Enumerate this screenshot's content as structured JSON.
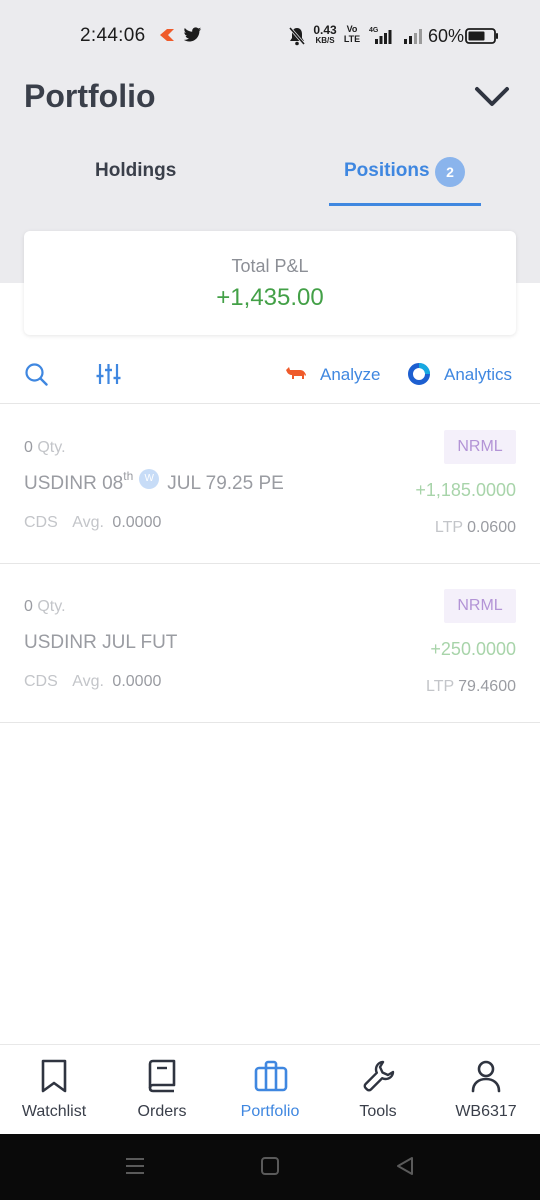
{
  "status_bar": {
    "time": "2:44:06",
    "net_speed": "0.43",
    "net_unit": "KB/S",
    "volte": "Vo LTE",
    "battery": "60%"
  },
  "header": {
    "title": "Portfolio"
  },
  "tabs": [
    {
      "label": "Holdings",
      "active": false
    },
    {
      "label": "Positions",
      "active": true,
      "badge": "2"
    }
  ],
  "pnl": {
    "label": "Total P&L",
    "value": "+1,435.00"
  },
  "toolbar": {
    "analyze_label": "Analyze",
    "analytics_label": "Analytics"
  },
  "positions": [
    {
      "qty": "0",
      "qty_label": "Qty.",
      "symbol_prefix": "USDINR 08",
      "symbol_sup": "th",
      "weekly_tag": "W",
      "symbol_suffix": "JUL 79.25 PE",
      "exchange": "CDS",
      "avg_label": "Avg.",
      "avg": "0.0000",
      "product": "NRML",
      "pnl": "+1,185.0000",
      "ltp_label": "LTP",
      "ltp": "0.0600"
    },
    {
      "qty": "0",
      "qty_label": "Qty.",
      "symbol": "USDINR JUL FUT",
      "exchange": "CDS",
      "avg_label": "Avg.",
      "avg": "0.0000",
      "product": "NRML",
      "pnl": "+250.0000",
      "ltp_label": "LTP",
      "ltp": "79.4600"
    }
  ],
  "bottom_nav": [
    {
      "label": "Watchlist",
      "icon": "bookmark-icon"
    },
    {
      "label": "Orders",
      "icon": "book-icon"
    },
    {
      "label": "Portfolio",
      "icon": "briefcase-icon",
      "active": true
    },
    {
      "label": "Tools",
      "icon": "wrench-icon"
    },
    {
      "label": "WB6317",
      "icon": "user-icon"
    }
  ],
  "colors": {
    "accent": "#3f87e0",
    "profit": "#43a047",
    "profit_muted": "#a8d4aa",
    "product_tag": "#b394d6",
    "header_bg": "#ebebee"
  }
}
